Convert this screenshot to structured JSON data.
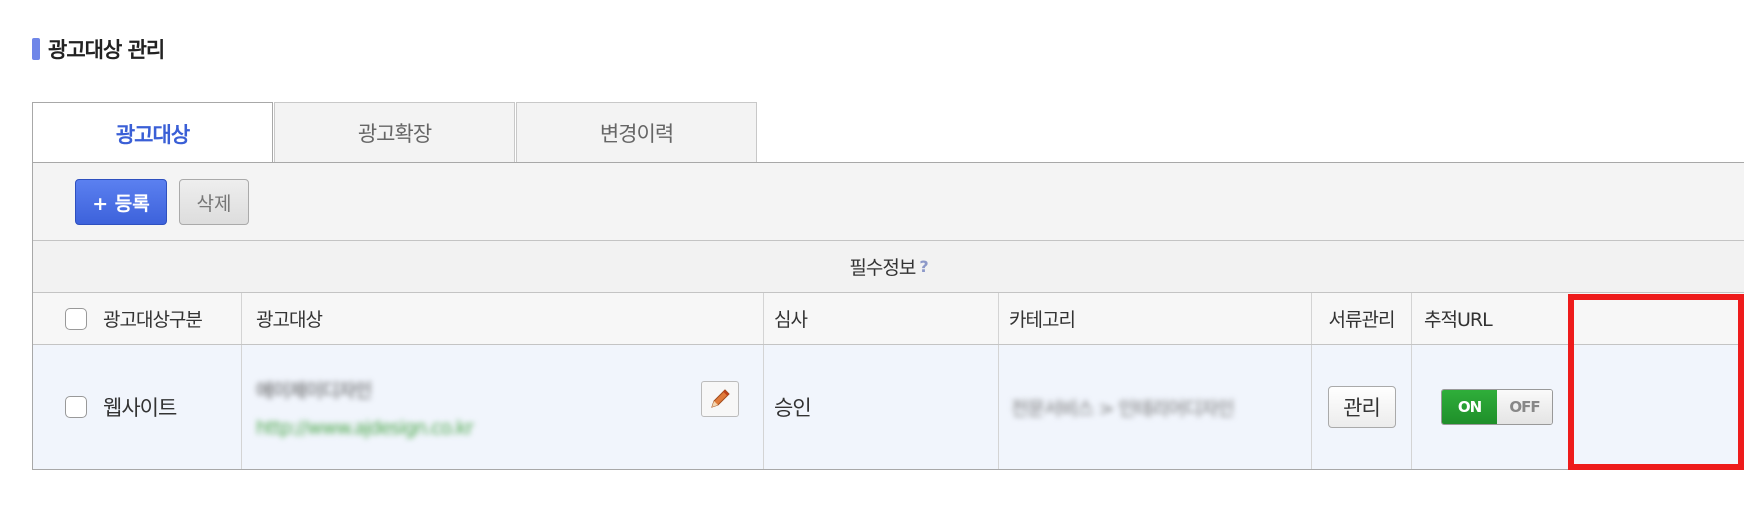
{
  "section": {
    "title": "광고대상 관리"
  },
  "tabs": [
    {
      "label": "광고대상",
      "active": true
    },
    {
      "label": "광고확장",
      "active": false
    },
    {
      "label": "변경이력",
      "active": false
    }
  ],
  "toolbar": {
    "register_label": "+ 등록",
    "delete_label": "삭제"
  },
  "table": {
    "group_header": "필수정보",
    "group_help": "?",
    "columns": [
      "광고대상구분",
      "광고대상",
      "심사",
      "카테고리",
      "서류관리",
      "추적URL"
    ],
    "rows": [
      {
        "type": "웹사이트",
        "target_name": "에이제이디자인",
        "target_url": "http://www.ajdesign.co.kr",
        "review": "승인",
        "category": "전문서비스 > 인테리어디자인",
        "docs_button": "관리",
        "tracking_on": "ON",
        "tracking_off": "OFF"
      }
    ]
  },
  "colors": {
    "accent": "#3a5fd6",
    "toggle_on": "#1f8f2a",
    "highlight": "#ee1b1b"
  }
}
